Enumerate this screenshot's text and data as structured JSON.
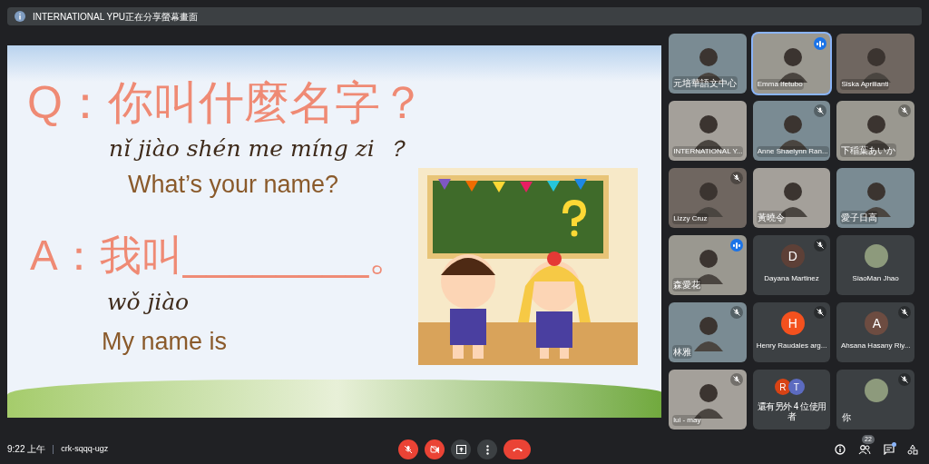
{
  "banner": {
    "text": "INTERNATIONAL YPU正在分享螢幕畫面"
  },
  "slide": {
    "question_mark": "Q",
    "question": "：你叫什麼名字？",
    "question_pinyin": "nǐ jiào shén me míng zi",
    "question_pinyin_mark": "？",
    "question_english": "What’s your name?",
    "answer_mark": "A",
    "answer": "：我叫________。",
    "answer_pinyin": "wǒ jiào",
    "answer_english": "My name is"
  },
  "tiles": [
    {
      "kind": "video",
      "name": "元培華語文中心",
      "muted": false,
      "speaking": false,
      "pinned": false
    },
    {
      "kind": "video",
      "name": "Emma Ifetubo",
      "muted": false,
      "speaking": true,
      "pinned": true
    },
    {
      "kind": "video",
      "name": "Siska Aprilianti",
      "muted": false,
      "speaking": false,
      "pinned": false
    },
    {
      "kind": "video",
      "name": "INTERNATIONAL Y...",
      "muted": false,
      "speaking": false,
      "pinned": false
    },
    {
      "kind": "video",
      "name": "Anne Shaelynn Ran...",
      "muted": true,
      "speaking": false,
      "pinned": false
    },
    {
      "kind": "video",
      "name": "下稲葉あいか",
      "muted": true,
      "speaking": false,
      "pinned": false
    },
    {
      "kind": "video",
      "name": "Lizzy Cruz",
      "muted": true,
      "speaking": false,
      "pinned": false
    },
    {
      "kind": "video",
      "name": "黃曉令",
      "muted": false,
      "speaking": false,
      "pinned": false
    },
    {
      "kind": "video",
      "name": "愛子日高",
      "muted": false,
      "speaking": false,
      "pinned": false
    },
    {
      "kind": "video",
      "name": "森愛花",
      "muted": false,
      "speaking": true,
      "pinned": false
    },
    {
      "kind": "avatar",
      "name": "Dayana Martinez",
      "letter": "D",
      "color": "#5d4037",
      "muted": true,
      "speaking": false,
      "pinned": false
    },
    {
      "kind": "photo",
      "name": "SiaoMan Jhao",
      "muted": false,
      "speaking": false,
      "pinned": false
    },
    {
      "kind": "video",
      "name": "林雅",
      "muted": true,
      "speaking": false,
      "pinned": false
    },
    {
      "kind": "avatar",
      "name": "Henry Raudales arg...",
      "letter": "H",
      "color": "#f4511e",
      "muted": true,
      "speaking": false,
      "pinned": false
    },
    {
      "kind": "avatar",
      "name": "Ahsana Hasany Riy...",
      "letter": "A",
      "color": "#6d4c41",
      "muted": true,
      "speaking": false,
      "pinned": false
    },
    {
      "kind": "video",
      "name": "lui - may",
      "muted": true,
      "speaking": false,
      "pinned": false
    },
    {
      "kind": "others",
      "name": "還有另外 4 位使用者",
      "avatars": [
        {
          "letter": "R",
          "color": "#d84315"
        },
        {
          "letter": "T",
          "color": "#5c6bc0"
        }
      ],
      "muted": false,
      "speaking": false,
      "pinned": false
    },
    {
      "kind": "photo",
      "name": "你",
      "muted": true,
      "speaking": false,
      "pinned": false
    }
  ],
  "bottom_bar": {
    "time": "9:22 上午",
    "meeting_code": "crk-sqqq-ugz",
    "mic_on": false,
    "camera_on": false,
    "people_count": "22",
    "chat_unread": true
  }
}
